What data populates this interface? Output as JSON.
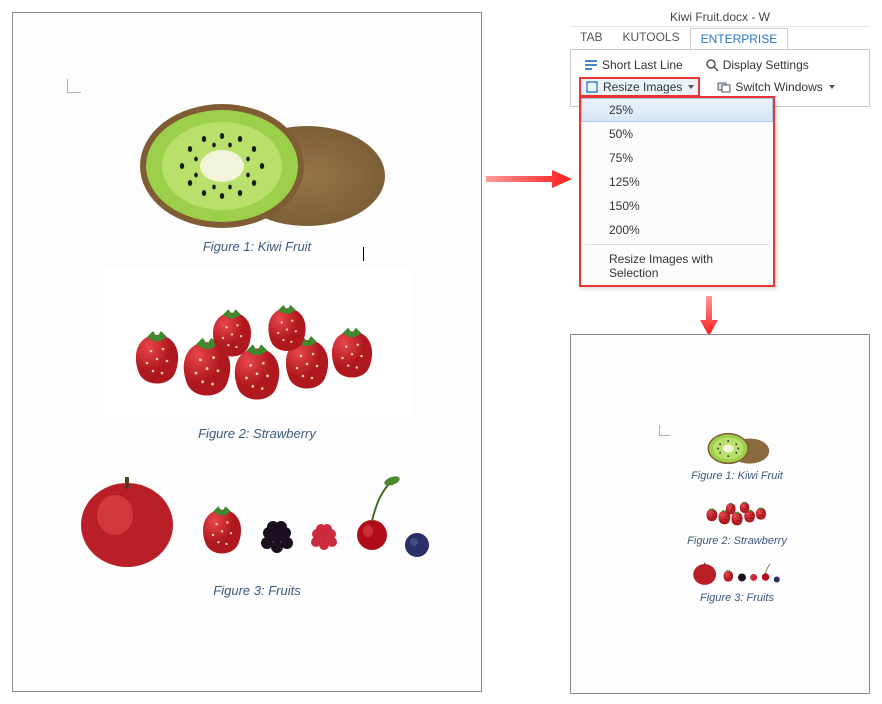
{
  "window": {
    "title": "Kiwi Fruit.docx - W"
  },
  "tabs": {
    "tab1": "TAB",
    "tab2": "KUTOOLS",
    "tab3": "ENTERPRISE"
  },
  "ribbon": {
    "short_last_line": "Short Last Line",
    "display_settings": "Display Settings",
    "resize_images": "Resize Images",
    "switch_windows": "Switch Windows"
  },
  "resize_menu": {
    "opt25": "25%",
    "opt50": "50%",
    "opt75": "75%",
    "opt125": "125%",
    "opt150": "150%",
    "opt200": "200%",
    "selection": "Resize Images with Selection"
  },
  "captions": {
    "fig1": "Figure 1: Kiwi Fruit",
    "fig2": "Figure 2: Strawberry",
    "fig3": "Figure 3: Fruits"
  }
}
